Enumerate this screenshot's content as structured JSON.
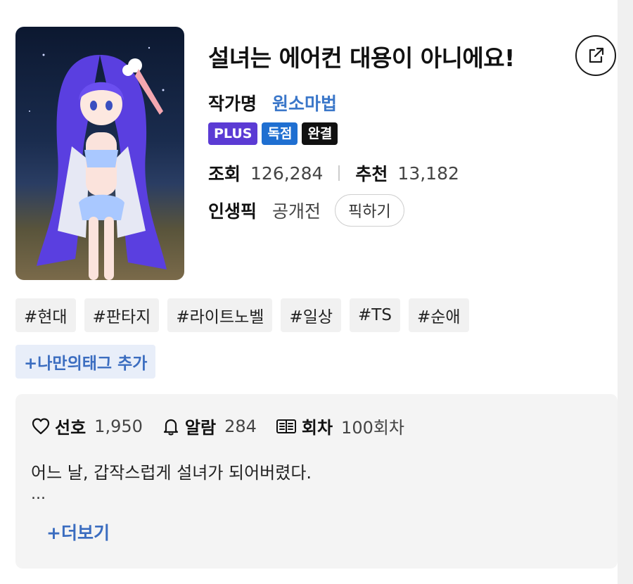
{
  "novel": {
    "title": "설녀는 에어컨 대용이 아니에요!",
    "author_label": "작가명",
    "author_name": "원소마법"
  },
  "badges": [
    {
      "label": "PLUS",
      "color": "#5b3bd4"
    },
    {
      "label": "독점",
      "color": "#1f6fd1"
    },
    {
      "label": "완결",
      "color": "#111111"
    }
  ],
  "stats": {
    "views_label": "조회",
    "views_value": "126,284",
    "recommend_label": "추천",
    "recommend_value": "13,182"
  },
  "life_pick": {
    "label": "인생픽",
    "status": "공개전",
    "button": "픽하기"
  },
  "tags": [
    "#현대",
    "#판타지",
    "#라이트노벨",
    "#일상",
    "#TS",
    "#순애"
  ],
  "add_tag": "+나만의태그 추가",
  "counts": {
    "favorite_label": "선호",
    "favorite_value": "1,950",
    "alarm_label": "알람",
    "alarm_value": "284",
    "episodes_label": "회차",
    "episodes_value": "100회차"
  },
  "synopsis": "어느 날, 갑작스럽게 설녀가 되어버렸다.",
  "synopsis_more": "...",
  "more_button": "+더보기",
  "icons": [
    "share-icon",
    "heart-icon",
    "bell-icon",
    "episode-list-icon"
  ]
}
